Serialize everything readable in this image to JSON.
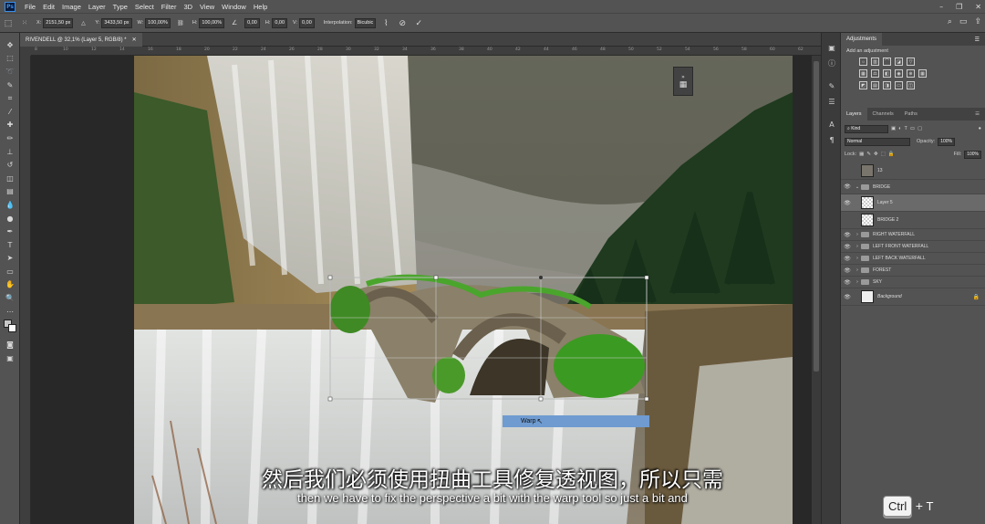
{
  "app": {
    "logo": "Ps"
  },
  "menu": [
    "File",
    "Edit",
    "Image",
    "Layer",
    "Type",
    "Select",
    "Filter",
    "3D",
    "View",
    "Window",
    "Help"
  ],
  "window_controls": [
    "–",
    "❐",
    "✕"
  ],
  "options_bar": {
    "x_label": "X:",
    "x_value": "2151,50 px",
    "y_label": "Y:",
    "y_value": "3433,50 px",
    "w_label": "W:",
    "w_value": "100,00%",
    "h_label": "H:",
    "h_value": "100,00%",
    "angle_value": "0,00",
    "hskew_label": "H:",
    "hskew_value": "0,00",
    "vskew_label": "V:",
    "vskew_value": "0,00",
    "interp_label": "Interpolation:",
    "interp_value": "Bicubic"
  },
  "document": {
    "tab_title": "RIVENDELL @ 32,1% (Layer 5, RGB/8) *"
  },
  "ruler_ticks": [
    "8",
    "10",
    "12",
    "14",
    "16",
    "18",
    "20",
    "22",
    "24",
    "26",
    "28",
    "30",
    "32",
    "34",
    "36",
    "38",
    "40",
    "42",
    "44",
    "46",
    "48",
    "50",
    "52",
    "54",
    "56",
    "58",
    "60",
    "62"
  ],
  "panels": {
    "adjustments_title": "Adjustments",
    "add_adjustment": "Add an adjustment",
    "layers_tabs": [
      "Layers",
      "Channels",
      "Paths"
    ],
    "kind": "Kind",
    "blend_mode": "Normal",
    "opacity_label": "Opacity:",
    "opacity_value": "100%",
    "lock_label": "Lock:",
    "fill_label": "Fill:",
    "fill_value": "100%"
  },
  "layers": [
    {
      "name": "13",
      "type": "image"
    },
    {
      "name": "BRIDGE",
      "type": "group"
    },
    {
      "name": "Layer 5",
      "type": "layer"
    },
    {
      "name": "BRIDGE 2",
      "type": "layer"
    },
    {
      "name": "RIGHT WATERFALL",
      "type": "group"
    },
    {
      "name": "LEFT FRONT WATERFALL",
      "type": "group"
    },
    {
      "name": "LEFT BACK WATERFALL",
      "type": "group"
    },
    {
      "name": "FOREST",
      "type": "group"
    },
    {
      "name": "SKY",
      "type": "group"
    },
    {
      "name": "Background",
      "type": "background"
    }
  ],
  "canvas_overlay": {
    "warp_tooltip": "Warp"
  },
  "subtitles": {
    "chinese": "然后我们必须使用扭曲工具修复透视图，所以只需",
    "english": "then we have to fix the perspective a bit with the warp tool so just a bit and"
  },
  "keys": {
    "key1": "Ctrl",
    "plus": "+",
    "key2": "T"
  }
}
